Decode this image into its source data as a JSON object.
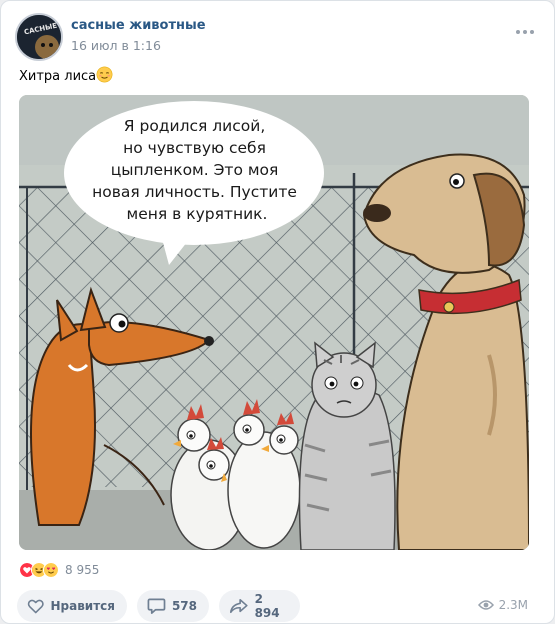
{
  "post": {
    "author": "сасные животные",
    "date": "16 июл в 1:16",
    "avatar_text": "САСНЫЕ",
    "text": "Хитра лиса",
    "text_emoji": "relieved-face-emoji"
  },
  "image": {
    "speech_bubble_lines": [
      "Я родился лисой,",
      "но чувствую себя",
      "цыпленком. Это моя",
      "новая личность. Пустите",
      "меня в курятник."
    ]
  },
  "reactions": {
    "icons": [
      "heart-reaction",
      "laughing-reaction",
      "heart-eyes-reaction"
    ],
    "count": "8 955"
  },
  "actions": {
    "like_label": "Нравится",
    "comments_count": "578",
    "shares_count": "2 894",
    "views_count": "2.3M"
  },
  "colors": {
    "author": "#2a5885",
    "muted": "#818c99",
    "button_bg": "#f0f2f5",
    "button_text": "#55677d"
  }
}
